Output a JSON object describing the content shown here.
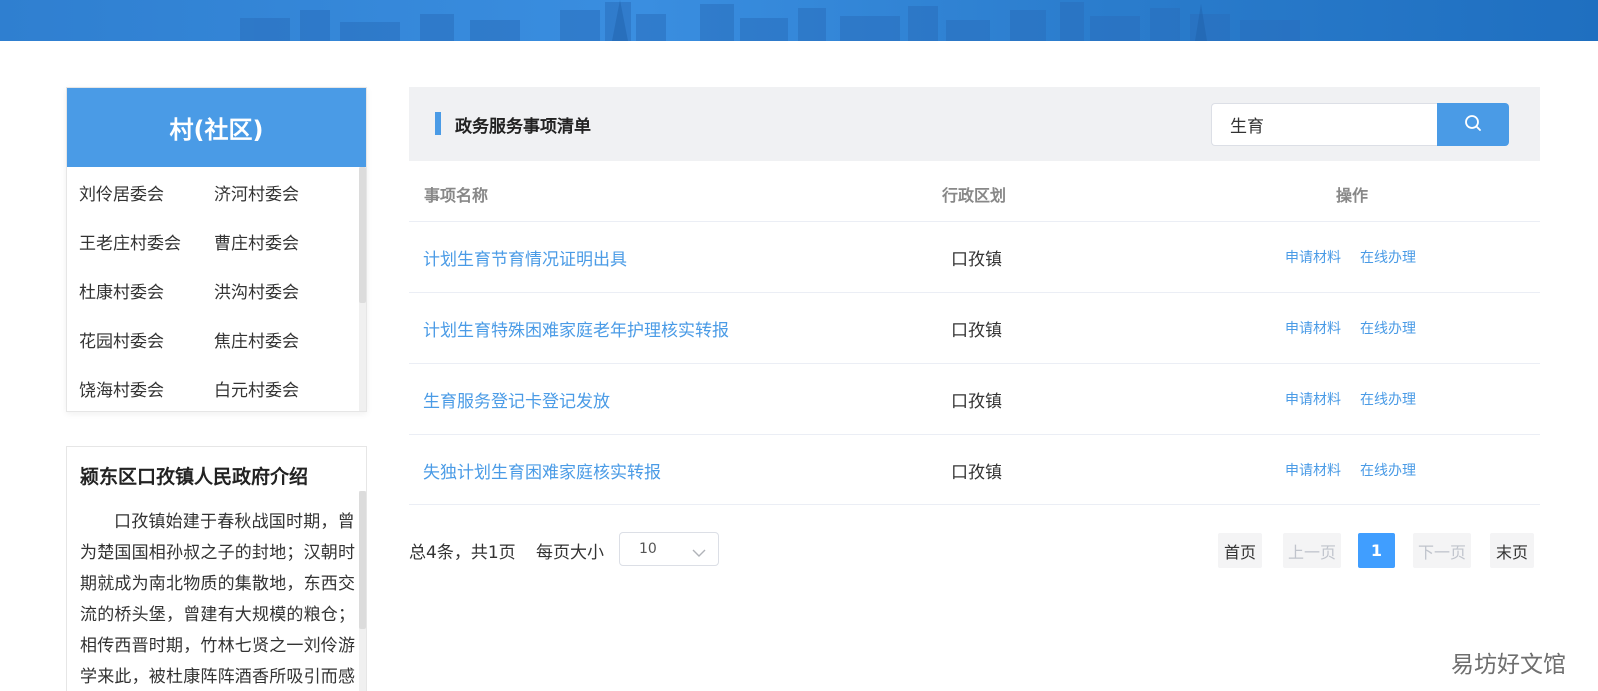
{
  "sidebar": {
    "villages_title": "村(社区)",
    "villages": [
      [
        "刘伶居委会",
        "济河村委会"
      ],
      [
        "王老庄村委会",
        "曹庄村委会"
      ],
      [
        "杜康村委会",
        "洪沟村委会"
      ],
      [
        "花园村委会",
        "焦庄村委会"
      ],
      [
        "饶海村委会",
        "白元村委会"
      ]
    ],
    "intro_title": "颍东区口孜镇人民政府介绍",
    "intro_text": "口孜镇始建于春秋战国时期，曾为楚国国相孙叔之子的封地；汉朝时期就成为南北物质的集散地，东西交流的桥头堡，曾建有大规模的粮仓；相传西晋时期，竹林七贤之一刘伶游学来此，被杜康阵阵酒香所吸引而感"
  },
  "main": {
    "title": "政务服务事项清单",
    "search": {
      "value": "生育",
      "icon": "search-icon"
    },
    "columns": [
      "事项名称",
      "行政区划",
      "操作"
    ],
    "rows": [
      {
        "name": "计划生育节育情况证明出具",
        "region": "口孜镇",
        "action1": "申请材料",
        "action2": "在线办理"
      },
      {
        "name": "计划生育特殊困难家庭老年护理核实转报",
        "region": "口孜镇",
        "action1": "申请材料",
        "action2": "在线办理"
      },
      {
        "name": "生育服务登记卡登记发放",
        "region": "口孜镇",
        "action1": "申请材料",
        "action2": "在线办理"
      },
      {
        "name": "失独计划生育困难家庭核实转报",
        "region": "口孜镇",
        "action1": "申请材料",
        "action2": "在线办理"
      }
    ]
  },
  "pagination": {
    "total_text": "总4条，共1页",
    "page_size_label": "每页大小",
    "page_size": "10",
    "first": "首页",
    "prev": "上一页",
    "current": "1",
    "next": "下一页",
    "last": "末页"
  },
  "watermark": "易坊好文馆",
  "colors": {
    "accent": "#4a9be6",
    "banner": "#2f7fd0",
    "active_page": "#409eff"
  }
}
